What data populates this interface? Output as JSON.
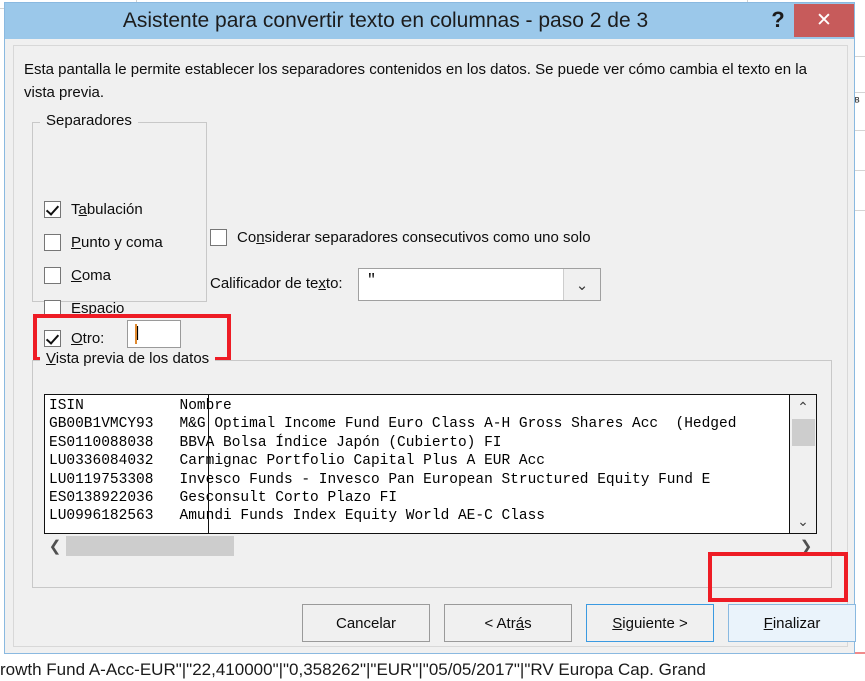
{
  "background": {
    "bottom_row_text": "rowth Fund A-Acc-EUR\"|\"22,410000\"|\"0,358262\"|\"EUR\"|\"05/05/2017\"|\"RV Europa Cap. Grand",
    "right_edge_glyph": "ᴮ"
  },
  "dialog": {
    "title": "Asistente para convertir texto en columnas - paso 2 de 3",
    "help_label": "?",
    "close_label": "✕",
    "instruction": "Esta pantalla le permite establecer los separadores contenidos en los datos. Se puede ver cómo cambia el texto en la vista previa."
  },
  "separators": {
    "legend": "Separadores",
    "items": [
      {
        "label_pre": "T",
        "accel": "a",
        "label_post": "bulación",
        "checked": true
      },
      {
        "label_pre": "",
        "accel": "P",
        "label_post": "unto y coma",
        "checked": false
      },
      {
        "label_pre": "",
        "accel": "C",
        "label_post": "oma",
        "checked": false
      },
      {
        "label_pre": "",
        "accel": "E",
        "label_post": "spacio",
        "checked": false
      },
      {
        "label_pre": "",
        "accel": "O",
        "label_post": "tro:",
        "checked": true
      }
    ],
    "other_value": "|"
  },
  "options": {
    "consecutive": {
      "label_pre": "Co",
      "accel": "n",
      "label_post": "siderar separadores consecutivos como uno solo",
      "checked": false
    },
    "qualifier_label_pre": "Calificador de te",
    "qualifier_accel": "x",
    "qualifier_label_post": "to:",
    "qualifier_value": "\"",
    "qualifier_arrow": "⌄"
  },
  "preview": {
    "legend_accel": "V",
    "legend_post": "ista previa de los datos",
    "lines": [
      "ISIN           Nombre",
      "GB00B1VMCY93   M&G Optimal Income Fund Euro Class A-H Gross Shares Acc  (Hedged",
      "ES0110088038   BBVA Bolsa Índice Japón (Cubierto) FI",
      "LU0336084032   Carmignac Portfolio Capital Plus A EUR Acc",
      "LU0119753308   Invesco Funds - Invesco Pan European Structured Equity Fund E",
      "ES0138922036   Gesconsult Corto Plazo FI",
      "LU0996182563   Amundi Funds Index Equity World AE-C Class"
    ],
    "scroll_up": "⌃",
    "scroll_down": "⌄",
    "scroll_left": "❮",
    "scroll_right": "❯"
  },
  "buttons": {
    "cancelar": "Cancelar",
    "atras_pre": "< Atr",
    "atras_accel": "á",
    "atras_post": "s",
    "siguiente_accel": "S",
    "siguiente_post": "iguiente >",
    "finalizar_accel": "F",
    "finalizar_post": "inalizar"
  },
  "colors": {
    "titlebar": "#9bc8ea",
    "close": "#c75b5b",
    "annotation_red": "#ee1c25",
    "focus_blue": "#3b9ae1"
  }
}
